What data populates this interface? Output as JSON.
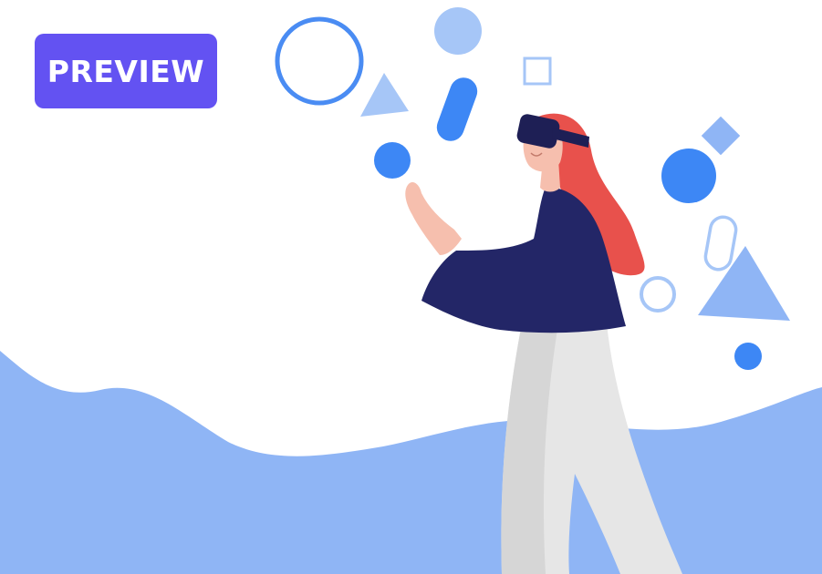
{
  "badge": {
    "label": "PREVIEW"
  },
  "colors": {
    "badge_bg": "#6352f2",
    "wave": "#8fb5f5",
    "shape_blue": "#3d87f5",
    "shape_light_blue": "#a6c6f7",
    "shape_outline_blue": "#4a8cf3",
    "shirt_navy": "#232667",
    "hair_red": "#e8514c",
    "skin": "#f6bfae",
    "pants_gray": "#e6e6e6",
    "headset_navy": "#1e1f55"
  },
  "illustration": {
    "subject": "woman-wearing-vr-headset-touching-floating-shapes",
    "icons": [
      "outline-circle-icon",
      "triangle-icon",
      "circle-icon",
      "pill-icon",
      "outline-square-icon",
      "diamond-icon",
      "outline-ring-icon",
      "outline-pill-icon"
    ]
  }
}
